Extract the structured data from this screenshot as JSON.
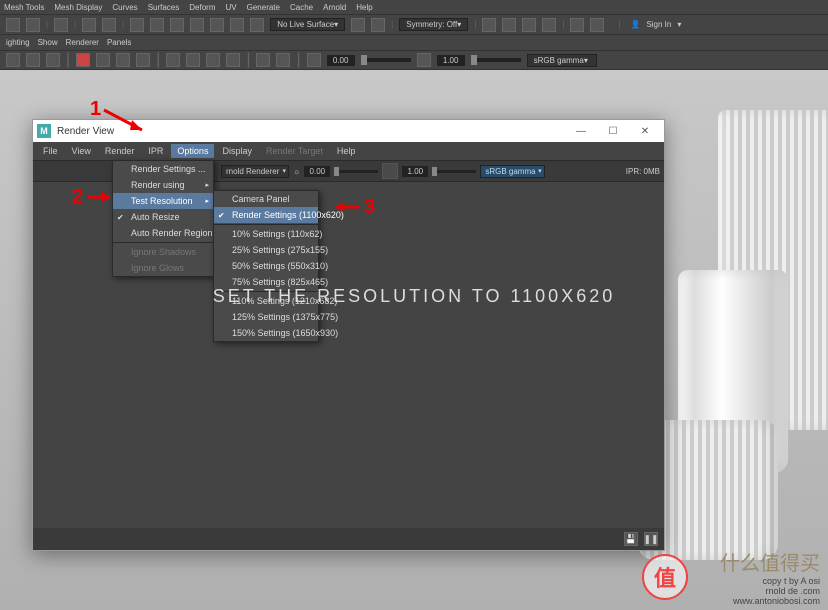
{
  "main_app": {
    "menubar": [
      "Mesh Tools",
      "Mesh Display",
      "Curves",
      "Surfaces",
      "Deform",
      "UV",
      "Generate",
      "Cache",
      "Arnold",
      "Help"
    ],
    "toolbar1": {
      "no_live_surface": "No Live Surface",
      "symmetry": "Symmetry: Off",
      "signin": "Sign In"
    },
    "toolbar2_tabs": [
      "ighting",
      "Show",
      "Renderer",
      "Panels"
    ],
    "toolbar3": {
      "num1": "0.00",
      "num2": "1.00",
      "gamma": "sRGB gamma"
    }
  },
  "render_view": {
    "title": "Render View",
    "win_min": "—",
    "win_max": "☐",
    "win_close": "✕",
    "menubar": [
      "File",
      "View",
      "Render",
      "IPR",
      "Options",
      "Display",
      "Render Target",
      "Help"
    ],
    "toolbar": {
      "renderer": "rnold Renderer",
      "exp_icon": "☼",
      "num1": "0.00",
      "num2": "1.00",
      "gamma": "sRGB gamma",
      "ipr": "IPR: 0MB"
    },
    "options_menu": [
      {
        "label": "Render Settings ..."
      },
      {
        "label": "Render using",
        "submenu": true
      },
      {
        "label": "Test Resolution",
        "submenu": true,
        "highlight": true
      },
      {
        "label": "Auto Resize",
        "checked": true
      },
      {
        "label": "Auto Render Region"
      },
      {
        "sep": true
      },
      {
        "label": "Ignore Shadows",
        "dim": true
      },
      {
        "label": "Ignore Glows",
        "dim": true
      }
    ],
    "test_res_menu": [
      {
        "label": "Camera Panel"
      },
      {
        "label": "Render Settings (1100x620)",
        "highlight": true,
        "checked": true
      },
      {
        "sep": true
      },
      {
        "label": "10% Settings (110x62)"
      },
      {
        "label": "25% Settings (275x155)"
      },
      {
        "label": "50% Settings (550x310)"
      },
      {
        "label": "75% Settings (825x465)"
      },
      {
        "sep": true
      },
      {
        "label": "110% Settings (1210x682)"
      },
      {
        "label": "125% Settings (1375x775)"
      },
      {
        "label": "150% Settings (1650x930)"
      }
    ],
    "big_text": "set the resolution to 1100x620"
  },
  "annotations": {
    "a1": "1",
    "a2": "2",
    "a3": "3"
  },
  "watermark": {
    "badge": "值",
    "phrase": "什么值得买",
    "line1": "copy    t by A          osi",
    "line2": "rnold          de          .com",
    "line3": "www.antoniobosi.com"
  }
}
